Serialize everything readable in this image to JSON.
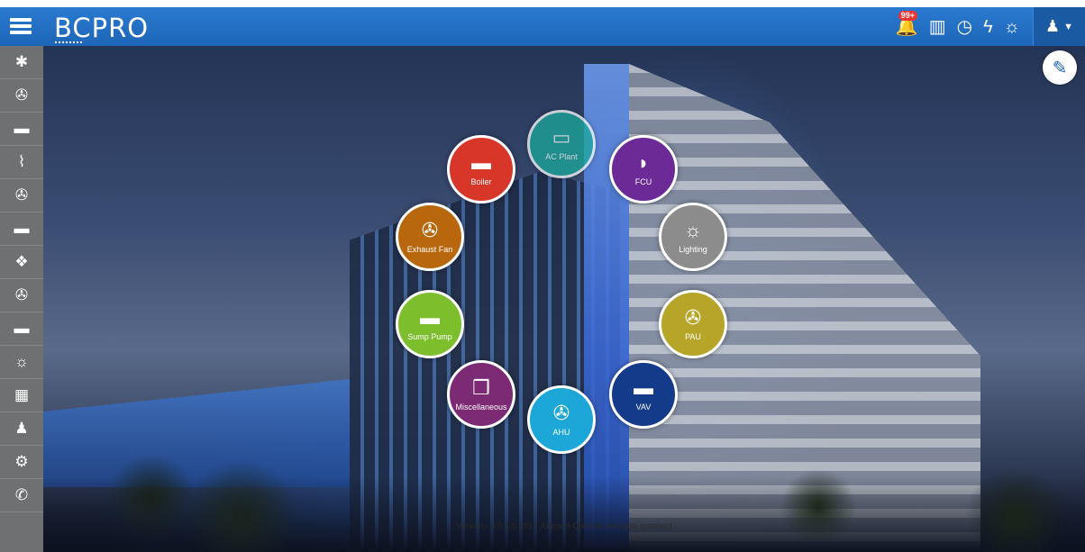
{
  "app": {
    "logo": "BCPRO"
  },
  "header": {
    "notification_badge": "99+",
    "icons": [
      "bell-icon",
      "chart-icon",
      "clock-icon",
      "lightning-icon",
      "weather-icon",
      "user-icon",
      "caret-down-icon"
    ]
  },
  "sidebar": {
    "items": [
      {
        "icon": "settings-icon",
        "glyph": "✱"
      },
      {
        "icon": "fan-icon",
        "glyph": "✇"
      },
      {
        "icon": "vav-icon",
        "glyph": "▬"
      },
      {
        "icon": "pipe-icon",
        "glyph": "⌇"
      },
      {
        "icon": "fan-icon",
        "glyph": "✇"
      },
      {
        "icon": "boiler-icon",
        "glyph": "▬"
      },
      {
        "icon": "ac-plant-icon",
        "glyph": "❖"
      },
      {
        "icon": "fan-icon",
        "glyph": "✇"
      },
      {
        "icon": "sump-icon",
        "glyph": "▬"
      },
      {
        "icon": "lightbulb-icon",
        "glyph": "☼"
      },
      {
        "icon": "building-icon",
        "glyph": "▦"
      },
      {
        "icon": "user-icon",
        "glyph": "♟"
      },
      {
        "icon": "gears-icon",
        "glyph": "⚙"
      },
      {
        "icon": "phone-icon",
        "glyph": "✆"
      }
    ]
  },
  "equipment": [
    {
      "label": "AC Plant",
      "color": "#1ba89a",
      "glyph": "▭"
    },
    {
      "label": "FCU",
      "color": "#6b2a96",
      "glyph": "◗"
    },
    {
      "label": "Lighting",
      "color": "#8c8c8c",
      "glyph": "☼"
    },
    {
      "label": "PAU",
      "color": "#b7a529",
      "glyph": "✇"
    },
    {
      "label": "VAV",
      "color": "#133b8a",
      "glyph": "▬"
    },
    {
      "label": "AHU",
      "color": "#1ca7d8",
      "glyph": "✇"
    },
    {
      "label": "Miscellaneous",
      "color": "#7b2a73",
      "glyph": "❒"
    },
    {
      "label": "Sump Pump",
      "color": "#7cbe2c",
      "glyph": "▬"
    },
    {
      "label": "Exhaust Fan",
      "color": "#b8670c",
      "glyph": "✇"
    },
    {
      "label": "Boiler",
      "color": "#d9362a",
      "glyph": "▬"
    }
  ],
  "footer": {
    "text": "Version - 3.0.4 © 2017 Johnson Controls. All rights reserved"
  }
}
